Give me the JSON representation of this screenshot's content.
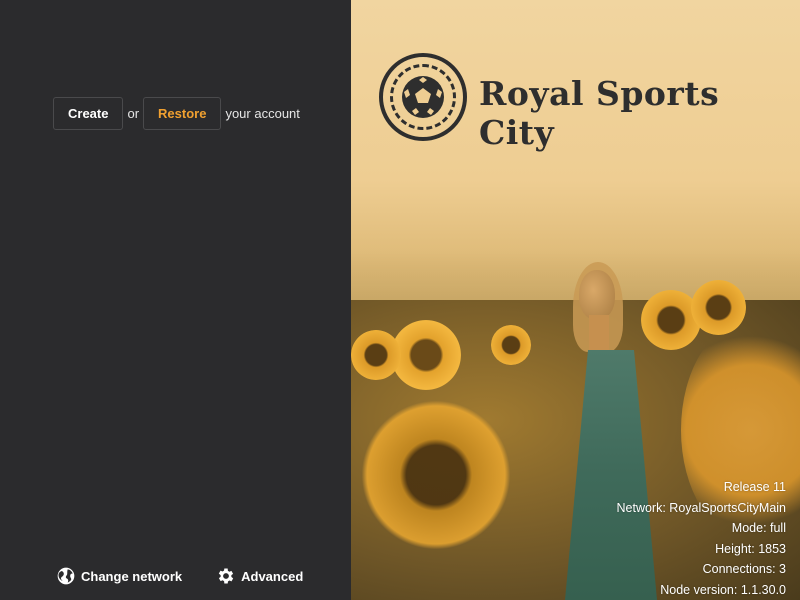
{
  "account": {
    "create_label": "Create",
    "or_text": "or",
    "restore_label": "Restore",
    "suffix_text": "your account"
  },
  "footer": {
    "change_network_label": "Change network",
    "change_network_icon": "globe-icon",
    "advanced_label": "Advanced",
    "advanced_icon": "gear-icon"
  },
  "brand": {
    "name": "Royal Sports City",
    "logo_icon": "soccer-ball-icon"
  },
  "status": {
    "release": "Release 11",
    "network": "Network: RoyalSportsCityMain",
    "mode": "Mode: full",
    "height": "Height: 1853",
    "connections": "Connections: 3",
    "node_version": "Node version: 1.1.30.0"
  },
  "colors": {
    "left_panel_bg": "#2b2b2d",
    "restore_accent": "#f0a030",
    "brand_text": "#2e2e2e"
  }
}
